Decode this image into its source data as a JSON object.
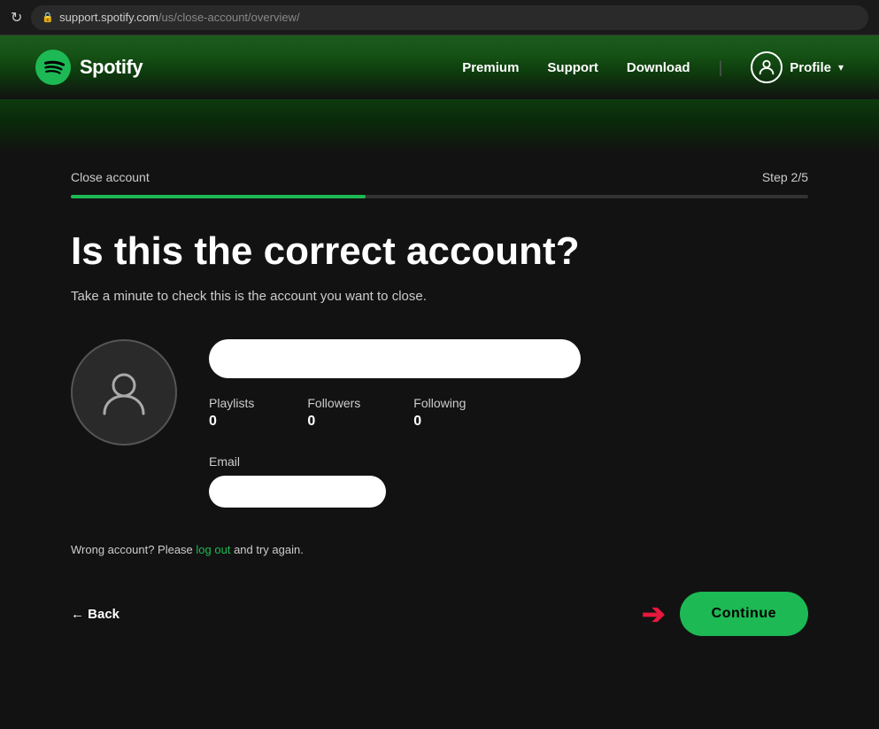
{
  "browser": {
    "url_base": "support.spotify.com",
    "url_path": "/us/close-account/overview/"
  },
  "navbar": {
    "logo_text": "Spotify",
    "nav_premium": "Premium",
    "nav_support": "Support",
    "nav_download": "Download",
    "nav_profile": "Profile"
  },
  "page": {
    "breadcrumb": "Close account",
    "step": "Step 2/5",
    "heading": "Is this the correct account?",
    "subtitle": "Take a minute to check this is the account you want to close.",
    "progress_percent": 40
  },
  "account": {
    "playlists_label": "Playlists",
    "playlists_value": "0",
    "followers_label": "Followers",
    "followers_value": "0",
    "following_label": "Following",
    "following_value": "0",
    "email_label": "Email"
  },
  "wrong_account": {
    "text_before": "Wrong account? Please ",
    "log_out_text": "log out",
    "text_after": " and try again."
  },
  "buttons": {
    "back_label": "← Back",
    "continue_label": "Continue"
  },
  "icons": {
    "refresh": "↻",
    "lock": "🔒",
    "person": "👤",
    "chevron_down": "▾",
    "arrow_right": "→"
  }
}
